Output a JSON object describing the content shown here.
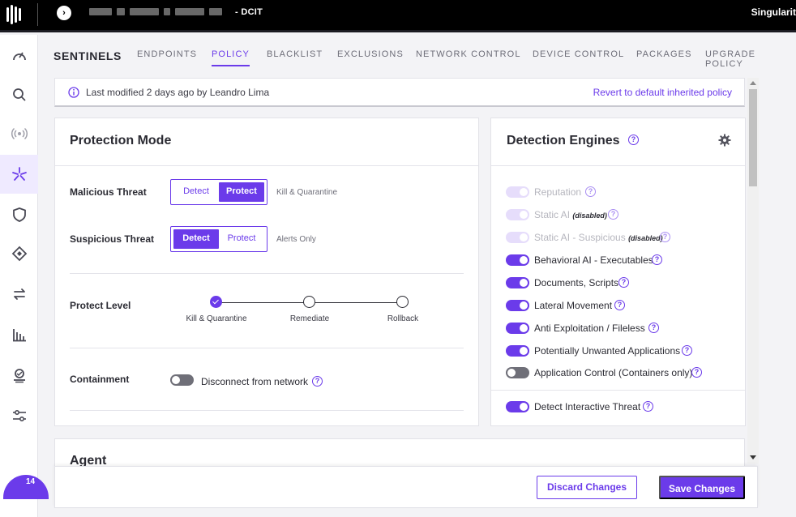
{
  "topbar": {
    "title": "- DCIT",
    "brand": "Singularit"
  },
  "nav": {
    "badge_count": "14",
    "items": [
      "dashboard-icon",
      "search-icon",
      "broadcast-icon",
      "sentinels-icon",
      "shield-icon",
      "diamond-icon",
      "sync-icon",
      "bar-chart-icon",
      "user-badge-icon",
      "sliders-icon"
    ]
  },
  "tabs": {
    "section_title": "SENTINELS",
    "items": [
      "ENDPOINTS",
      "POLICY",
      "BLACKLIST",
      "EXCLUSIONS",
      "NETWORK CONTROL",
      "DEVICE CONTROL",
      "PACKAGES",
      "UPGRADE POLICY"
    ],
    "active": "POLICY"
  },
  "banner": {
    "text": "Last modified 2 days ago by Leandro Lima",
    "link": "Revert to default inherited policy"
  },
  "protection": {
    "title": "Protection Mode",
    "malicious": {
      "label": "Malicious Threat",
      "options": [
        "Detect",
        "Protect"
      ],
      "selected": "Protect",
      "desc": "Kill & Quarantine"
    },
    "suspicious": {
      "label": "Suspicious Threat",
      "options": [
        "Detect",
        "Protect"
      ],
      "selected": "Detect",
      "desc": "Alerts Only"
    },
    "level": {
      "label": "Protect Level",
      "steps": [
        "Kill & Quarantine",
        "Remediate",
        "Rollback"
      ],
      "selected": "Kill & Quarantine"
    },
    "containment": {
      "label": "Containment",
      "toggle_label": "Disconnect from network",
      "enabled": false
    }
  },
  "engines": {
    "title": "Detection Engines",
    "items": [
      {
        "label": "Reputation",
        "state": "disabled",
        "note": ""
      },
      {
        "label": "Static AI",
        "state": "disabled",
        "note": "(disabled)"
      },
      {
        "label": "Static AI - Suspicious",
        "state": "disabled",
        "note": "(disabled)"
      },
      {
        "label": "Behavioral AI - Executables",
        "state": "on",
        "note": ""
      },
      {
        "label": "Documents, Scripts",
        "state": "on",
        "note": ""
      },
      {
        "label": "Lateral Movement",
        "state": "on",
        "note": ""
      },
      {
        "label": "Anti Exploitation / Fileless",
        "state": "on",
        "note": ""
      },
      {
        "label": "Potentially Unwanted Applications",
        "state": "on",
        "note": ""
      },
      {
        "label": "Application Control (Containers only)",
        "state": "off",
        "note": ""
      },
      {
        "label": "Detect Interactive Threat",
        "state": "on",
        "note": ""
      }
    ]
  },
  "agent": {
    "title": "Agent"
  },
  "footer": {
    "discard_label": "Discard Changes",
    "save_label": "Save Changes"
  },
  "colors": {
    "accent": "#6b3bea",
    "toggle_off": "#6f6f78",
    "toggle_disabled": "#e6ddfb"
  }
}
